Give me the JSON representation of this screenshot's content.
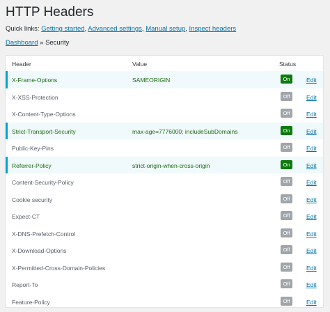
{
  "page": {
    "title": "HTTP Headers"
  },
  "quick_links": {
    "label": "Quick links:",
    "links": [
      "Getting started",
      "Advanced settings",
      "Manual setup",
      "Inspect headers"
    ]
  },
  "breadcrumb": {
    "root": "Dashboard",
    "separator": "»",
    "current": "Security"
  },
  "table": {
    "columns": {
      "header": "Header",
      "value": "Value",
      "status": "Status"
    },
    "edit_label": "Edit",
    "rows": [
      {
        "header": "X-Frame-Options",
        "value": "SAMEORIGIN",
        "status": "On"
      },
      {
        "header": "X-XSS-Protection",
        "value": "",
        "status": "Off"
      },
      {
        "header": "X-Content-Type-Options",
        "value": "",
        "status": "Off"
      },
      {
        "header": "Strict-Transport-Security",
        "value": "max-age=7776000; includeSubDomains",
        "status": "On"
      },
      {
        "header": "Public-Key-Pins",
        "value": "",
        "status": "Off"
      },
      {
        "header": "Referrer-Policy",
        "value": "strict-origin-when-cross-origin",
        "status": "On"
      },
      {
        "header": "Content-Security-Policy",
        "value": "",
        "status": "Off"
      },
      {
        "header": "Cookie security",
        "value": "",
        "status": "Off"
      },
      {
        "header": "Expect-CT",
        "value": "",
        "status": "Off"
      },
      {
        "header": "X-DNS-Prefetch-Control",
        "value": "",
        "status": "Off"
      },
      {
        "header": "X-Download-Options",
        "value": "",
        "status": "Off"
      },
      {
        "header": "X-Permitted-Cross-Domain-Policies",
        "value": "",
        "status": "Off"
      },
      {
        "header": "Report-To",
        "value": "",
        "status": "Off"
      },
      {
        "header": "Feature-Policy",
        "value": "",
        "status": "Off"
      }
    ]
  },
  "colors": {
    "status_on": "#0e7a0d",
    "status_off": "#a0a5aa",
    "active_row_bg": "#f0f9fc",
    "active_row_border": "#00a0d2",
    "link": "#0073aa"
  }
}
